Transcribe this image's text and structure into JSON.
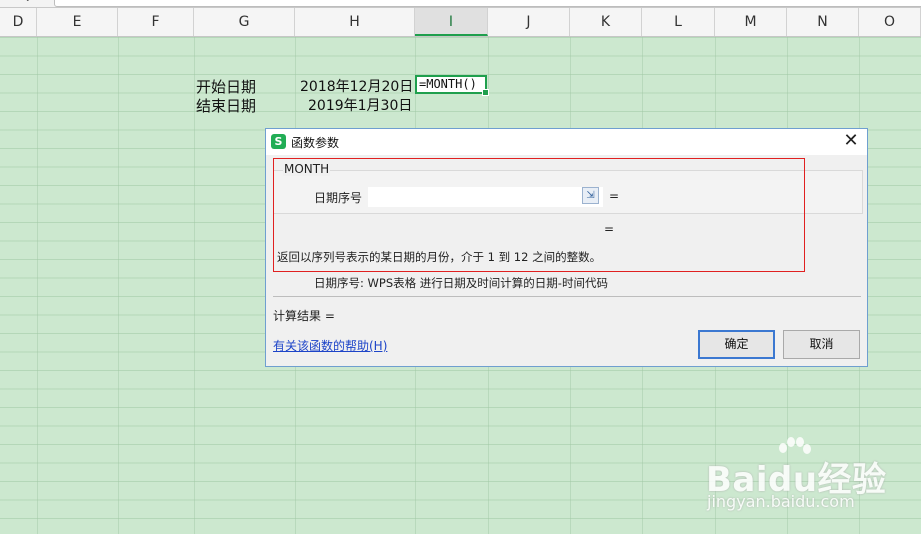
{
  "formula_bar": {
    "chevron": "⌄"
  },
  "columns": [
    "D",
    "E",
    "F",
    "G",
    "H",
    "I",
    "J",
    "K",
    "L",
    "M",
    "N",
    "O"
  ],
  "active_column": "I",
  "cells": {
    "g_row1": "开始日期",
    "g_row2": "结束日期",
    "h_row1": "2018年12月20日",
    "h_row2": "2019年1月30日",
    "i_row1": "=MONTH()"
  },
  "dialog": {
    "logo": "S",
    "title": "函数参数",
    "close": "✕",
    "function_name": "MONTH",
    "param_label": "日期序号",
    "param_value": "",
    "equals": "=",
    "result_equals": "=",
    "description": "返回以序列号表示的某日期的月份，介于 1 到 12 之间的整数。",
    "param_help": "日期序号:   WPS表格 进行日期及时间计算的日期-时间代码",
    "calc_result": "计算结果  =",
    "help_link": "有关该函数的帮助(H)",
    "ok": "确定",
    "cancel": "取消"
  },
  "watermark": {
    "brand": "Baidu经验",
    "url": "jingyan.baidu.com"
  },
  "colors": {
    "accent_green": "#1f9f4d",
    "highlight_red": "#e02020",
    "link_blue": "#1d44c8",
    "sheet_bg": "#cce8cf"
  }
}
